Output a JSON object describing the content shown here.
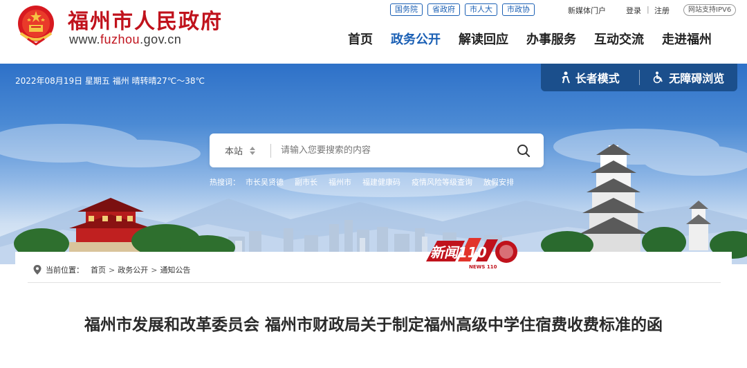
{
  "header": {
    "site_name": "福州市人民政府",
    "url_prefix": "www.",
    "url_highlight": "fuzhou",
    "url_suffix": ".gov.cn",
    "top_links": [
      "国务院",
      "省政府",
      "市人大",
      "市政协"
    ],
    "new_media": "新媒体门户",
    "login": "登录",
    "register": "注册",
    "ipv6": "网站支持IPV6",
    "nav": [
      "首页",
      "政务公开",
      "解读回应",
      "办事服务",
      "互动交流",
      "走进福州"
    ],
    "active_nav": "政务公开"
  },
  "banner": {
    "date_weather": "2022年08月19日 星期五 福州 晴转晴27℃～38℃",
    "elder_mode": "长者模式",
    "accessibility": "无障碍浏览",
    "search_scope": "本站",
    "search_placeholder": "请输入您要搜索的内容",
    "hot_label": "热搜词：",
    "hot_words": [
      "市长吴贤德",
      "副市长",
      "福州市",
      "福建健康码",
      "疫情风险等级查询",
      "放假安排"
    ]
  },
  "stamp": {
    "text": "新闻110",
    "sub": "NEWS 110"
  },
  "content": {
    "location_label": "当前位置：",
    "breadcrumb": [
      "首页",
      "政务公开",
      "通知公告"
    ],
    "breadcrumb_sep": ">",
    "title": "福州市发展和改革委员会 福州市财政局关于制定福州高级中学住宿费收费标准的函"
  },
  "colors": {
    "brand_red": "#c0121c",
    "nav_blue": "#1a5fb4",
    "access_bar": "#1b4f8c"
  }
}
